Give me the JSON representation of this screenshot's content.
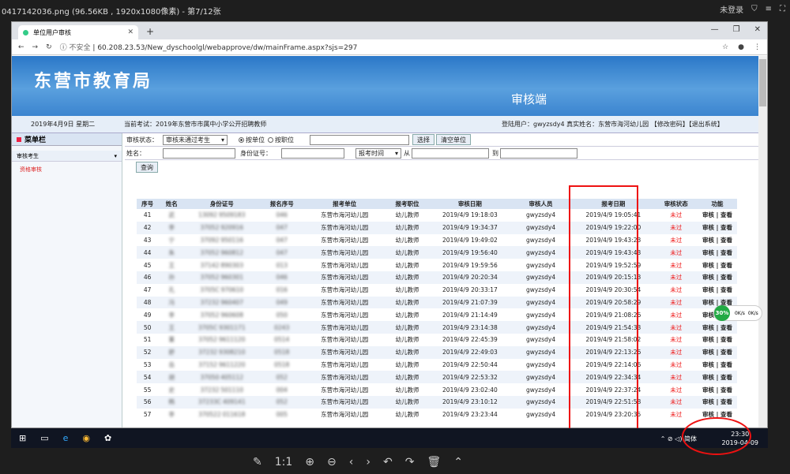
{
  "viewer": {
    "title": "0417142036.png (96.56KB , 1920x1080像素) - 第7/12张",
    "login": "未登录",
    "tools": [
      "✎",
      "1:1",
      "⊕",
      "⊖",
      "‹",
      "›",
      "↶",
      "↷",
      "🗑",
      "⌃"
    ]
  },
  "browser": {
    "tab_title": "单位用户审核",
    "url_secure_label": "不安全",
    "url": "60.208.23.53/New_dyschoolgl/webapprove/dw/mainFrame.aspx?sjs=297"
  },
  "banner": {
    "city": "东营市教育局",
    "side": "审核端"
  },
  "infobar": {
    "date": "2019年4月9日 星期二",
    "exam": "当前考试：2019年东营市市属中小学公开招聘教师",
    "user": "登陆用户：gwyzsdy4    真实姓名：东营市海河幼儿园    【修改密码】【退出系统】"
  },
  "menu": {
    "header": "菜单栏",
    "group": "审核考生",
    "item": "资格审核"
  },
  "filters": {
    "status_label": "审核状态：",
    "status_value": "审核未通过考生",
    "radio_unit": "按单位",
    "radio_position": "按职位",
    "select_btn": "选择",
    "clear_btn": "清空单位",
    "name_label": "姓名：",
    "id_label": "身份证号：",
    "time_select": "报考时间",
    "from_label": "从",
    "to_label": "到",
    "query_btn": "查询"
  },
  "table": {
    "headers": [
      "序号",
      "姓名",
      "身份证号",
      "报名序号",
      "报考单位",
      "报考职位",
      "审核日期",
      "审核人员",
      "报考日期",
      "审核状态",
      "功能"
    ],
    "rows": [
      [
        "41",
        "武",
        "13092",
        "9509183",
        "046",
        "东营市海河幼儿园",
        "幼儿教师",
        "2019/4/9 19:18:03",
        "gwyzsdy4",
        "2019/4/9 19:05:41",
        "未过",
        "审核 | 查看"
      ],
      [
        "42",
        "李",
        "37052",
        "920916",
        "047",
        "东营市海河幼儿园",
        "幼儿教师",
        "2019/4/9 19:34:37",
        "gwyzsdy4",
        "2019/4/9 19:22:00",
        "未过",
        "审核 | 查看"
      ],
      [
        "43",
        "宁",
        "37092",
        "950116",
        "047",
        "东营市海河幼儿园",
        "幼儿教师",
        "2019/4/9 19:49:02",
        "gwyzsdy4",
        "2019/4/9 19:43:23",
        "未过",
        "审核 | 查看"
      ],
      [
        "44",
        "朱",
        "37052",
        "960812",
        "047",
        "东营市海河幼儿园",
        "幼儿教师",
        "2019/4/9 19:56:40",
        "gwyzsdy4",
        "2019/4/9 19:43:43",
        "未过",
        "审核 | 查看"
      ],
      [
        "45",
        "王",
        "37142",
        "890303",
        "013",
        "东营市海河幼儿园",
        "幼儿教师",
        "2019/4/9 19:59:56",
        "gwyzsdy4",
        "2019/4/9 19:52:59",
        "未过",
        "审核 | 查看"
      ],
      [
        "46",
        "孙",
        "37052",
        "960301",
        "046",
        "东营市海河幼儿园",
        "幼儿教师",
        "2019/4/9 20:20:34",
        "gwyzsdy4",
        "2019/4/9 20:15:13",
        "未过",
        "审核 | 查看"
      ],
      [
        "47",
        "孔",
        "3705C",
        "970610",
        "016",
        "东营市海河幼儿园",
        "幼儿教师",
        "2019/4/9 20:33:17",
        "gwyzsdy4",
        "2019/4/9 20:30:54",
        "未过",
        "审核 | 查看"
      ],
      [
        "48",
        "冯",
        "37232",
        "960407",
        "049",
        "东营市海河幼儿园",
        "幼儿教师",
        "2019/4/9 21:07:39",
        "gwyzsdy4",
        "2019/4/9 20:58:29",
        "未过",
        "审核 | 查看"
      ],
      [
        "49",
        "李",
        "37052",
        "960608",
        "050",
        "东营市海河幼儿园",
        "幼儿教师",
        "2019/4/9 21:14:49",
        "gwyzsdy4",
        "2019/4/9 21:08:26",
        "未过",
        "审核 | 查看"
      ],
      [
        "50",
        "王",
        "3705C",
        "9301171",
        "0243",
        "东营市海河幼儿园",
        "幼儿教师",
        "2019/4/9 23:14:38",
        "gwyzsdy4",
        "2019/4/9 21:54:33",
        "未过",
        "审核 | 查看"
      ],
      [
        "51",
        "董",
        "37052",
        "9611120",
        "0514",
        "东营市海河幼儿园",
        "幼儿教师",
        "2019/4/9 22:45:39",
        "gwyzsdy4",
        "2019/4/9 21:58:02",
        "未过",
        "审核 | 查看"
      ],
      [
        "52",
        "舒",
        "37232",
        "9308210",
        "0518",
        "东营市海河幼儿园",
        "幼儿教师",
        "2019/4/9 22:49:03",
        "gwyzsdy4",
        "2019/4/9 22:13:26",
        "未过",
        "审核 | 查看"
      ],
      [
        "53",
        "岳",
        "37152",
        "9611220",
        "0518",
        "东营市海河幼儿园",
        "幼儿教师",
        "2019/4/9 22:50:44",
        "gwyzsdy4",
        "2019/4/9 22:14:06",
        "未过",
        "审核 | 查看"
      ],
      [
        "54",
        "胡",
        "37050",
        "405112",
        "052",
        "东营市海河幼儿园",
        "幼儿教师",
        "2019/4/9 22:53:32",
        "gwyzsdy4",
        "2019/4/9 22:34:34",
        "未过",
        "审核 | 查看"
      ],
      [
        "55",
        "史",
        "37232",
        "501110",
        "004",
        "东营市海河幼儿园",
        "幼儿教师",
        "2019/4/9 23:02:40",
        "gwyzsdy4",
        "2019/4/9 22:37:24",
        "未过",
        "审核 | 查看"
      ],
      [
        "56",
        "韩",
        "37233C",
        "409141",
        "052",
        "东营市海河幼儿园",
        "幼儿教师",
        "2019/4/9 23:10:12",
        "gwyzsdy4",
        "2019/4/9 22:51:58",
        "未过",
        "审核 | 查看"
      ],
      [
        "57",
        "李",
        "370522",
        "011618",
        "005",
        "东营市海河幼儿园",
        "幼儿教师",
        "2019/4/9 23:23:44",
        "gwyzsdy4",
        "2019/4/9 23:20:35",
        "未过",
        "审核 | 查看"
      ]
    ]
  },
  "floating": {
    "percent": "30%",
    "up": "0K/s",
    "down": "0K/s"
  },
  "taskbar": {
    "ime": "简体",
    "time": "23:30",
    "date": "2019-04-09"
  },
  "colors": {
    "fail": "#ee1111",
    "banner": "#2b78c8",
    "highlight": "#ee1111"
  }
}
